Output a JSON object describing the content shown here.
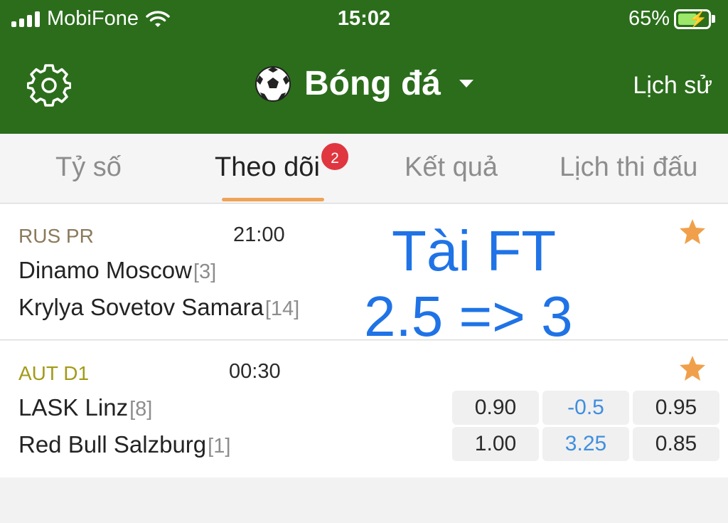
{
  "status_bar": {
    "carrier": "MobiFone",
    "time": "15:02",
    "battery": "65%",
    "battery_level": 0.65
  },
  "header": {
    "title": "Bóng đá",
    "history_label": "Lịch sử"
  },
  "tabs": [
    {
      "label": "Tỷ số",
      "active": false
    },
    {
      "label": "Theo dõi",
      "active": true,
      "badge": "2"
    },
    {
      "label": "Kết quả",
      "active": false
    },
    {
      "label": "Lịch thi đấu",
      "active": false
    }
  ],
  "matches": [
    {
      "league": "RUS PR",
      "league_color": "#8a7a5c",
      "time": "21:00",
      "home": {
        "name": "Dinamo Moscow",
        "rank": "[3]"
      },
      "away": {
        "name": "Krylya Sovetov Samara",
        "rank": "[14]"
      },
      "starred": true
    },
    {
      "league": "AUT D1",
      "league_color": "#a39a19",
      "time": "00:30",
      "home": {
        "name": "LASK Linz",
        "rank": "[8]"
      },
      "away": {
        "name": "Red Bull Salzburg",
        "rank": "[1]"
      },
      "starred": true,
      "odds": {
        "row1": [
          "0.90",
          "-0.5",
          "0.95"
        ],
        "row2": [
          "1.00",
          "3.25",
          "0.85"
        ]
      }
    }
  ],
  "overlay": {
    "line1": "Tài FT",
    "line2": "2.5 => 3"
  },
  "colors": {
    "header_green": "#2b6d1b",
    "tab_underline": "#f0a256",
    "badge_red": "#e0363f",
    "star_orange": "#f0a04b",
    "odds_line_blue": "#3f8fe0",
    "overlay_blue": "#1f73e6"
  },
  "icons": {
    "settings": "gear-icon",
    "sport": "soccer-ball-icon",
    "dropdown": "caret-down-icon",
    "favorite": "star-icon",
    "wifi": "wifi-icon",
    "battery": "battery-charging-icon"
  }
}
